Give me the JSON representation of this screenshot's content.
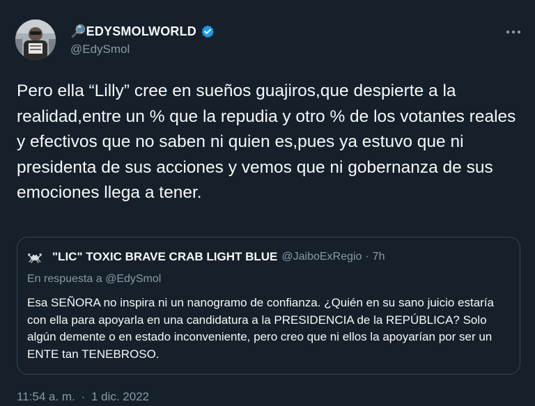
{
  "tweet": {
    "display_name": "🔎EDYSMOLWORLD",
    "handle": "@EdySmol",
    "text": "Pero ella “Lilly” cree en sueños guajiros,que despierte a la realidad,entre un % que la repudia y otro % de los votantes reales y efectivos que no saben ni quien es,pues ya estuvo que ni presidenta de sus acciones y vemos que ni gobernanza de sus emociones llega a tener.",
    "time": "11:54 a. m.",
    "separator": "·",
    "date": "1 dic. 2022",
    "icons": {
      "verified": "verified-badge-icon",
      "more": "more-options-icon"
    }
  },
  "quote": {
    "display_name": "\"LIC\" TOXIC BRAVE CRAB LIGHT BLUE",
    "handle": "@JaiboExRegio",
    "separator": "·",
    "time": "7h",
    "reply_to": "En respuesta a @EdySmol",
    "text": "Esa SEÑORA no inspira ni un nanogramo de confianza. ¿Quién en su sano juicio estaría con ella para apoyarla en una candidatura a la PRESIDENCIA de la REPÚBLICA? Solo algún demente o en estado inconveniente, pero creo que ni ellos la apoyarían por ser un ENTE tan TENEBROSO."
  },
  "colors": {
    "background": "#15202b",
    "text": "#f7f9f9",
    "secondary": "#8b98a5",
    "border": "#38444d",
    "verified": "#1d9bf0"
  }
}
